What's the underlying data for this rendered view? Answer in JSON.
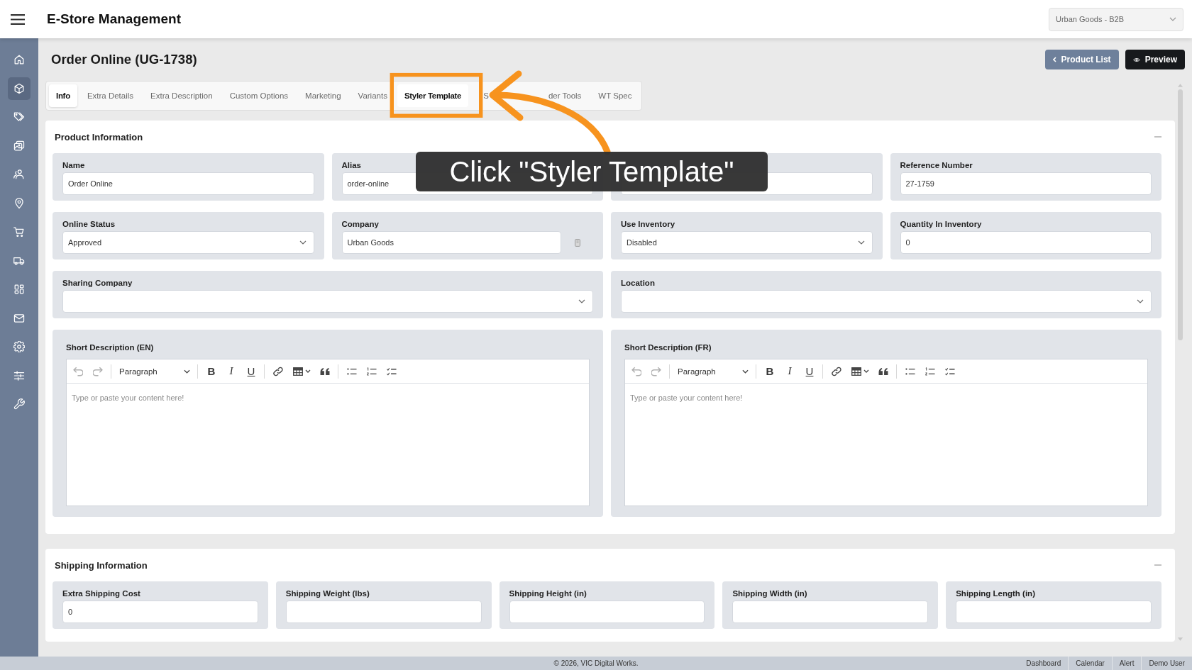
{
  "header": {
    "app_title": "E-Store Management",
    "store_selector": {
      "value": "Urban Goods - B2B"
    }
  },
  "sidebar": {
    "items": [
      {
        "selected": false
      },
      {
        "selected": true
      },
      {
        "selected": false
      },
      {
        "selected": false
      },
      {
        "selected": false
      },
      {
        "selected": false
      },
      {
        "selected": false
      },
      {
        "selected": false
      },
      {
        "selected": false
      },
      {
        "selected": false
      },
      {
        "selected": false
      },
      {
        "selected": false
      },
      {
        "selected": false
      }
    ]
  },
  "page": {
    "title": "Order Online (UG-1738)",
    "actions": [
      {
        "label": "Product List",
        "kind": "back"
      },
      {
        "label": "Preview",
        "kind": "preview"
      }
    ]
  },
  "tabs": [
    {
      "label": "Info",
      "selected": true,
      "hovered": false,
      "kind": "full"
    },
    {
      "label": "Extra Details",
      "selected": false,
      "hovered": false,
      "kind": "full"
    },
    {
      "label": "Extra Description",
      "selected": false,
      "hovered": false,
      "kind": "full"
    },
    {
      "label": "Custom Options",
      "selected": false,
      "hovered": false,
      "kind": "full"
    },
    {
      "label": "Marketing",
      "selected": false,
      "hovered": false,
      "kind": "full"
    },
    {
      "label": "Variants",
      "selected": false,
      "hovered": false,
      "kind": "full"
    },
    {
      "label": "Styler Template",
      "selected": false,
      "hovered": true,
      "kind": "full"
    },
    {
      "label": "S",
      "selected": false,
      "hovered": false,
      "kind": "cut_end"
    },
    {
      "label": "der Tools",
      "selected": false,
      "hovered": false,
      "kind": "cut_start"
    },
    {
      "label": "WT Spec",
      "selected": false,
      "hovered": false,
      "kind": "full"
    }
  ],
  "callout": {
    "text": "Click \"Styler Template\""
  },
  "product_information": {
    "title": "Product Information",
    "rows": [
      [
        {
          "kind": "text",
          "label": "Name",
          "value": "Order Online"
        },
        {
          "kind": "text",
          "label": "Alias",
          "value": "order-online"
        },
        {
          "kind": "text"
        },
        {
          "kind": "text",
          "label": "Reference Number",
          "value": "27-1759"
        }
      ],
      [
        {
          "kind": "select",
          "label": "Online Status",
          "value": "Approved"
        },
        {
          "kind": "text_with_icon",
          "label": "Company",
          "value": "Urban Goods"
        },
        {
          "kind": "select",
          "label": "Use Inventory",
          "value": "Disabled"
        },
        {
          "kind": "text",
          "label": "Quantity In Inventory",
          "value": "0"
        }
      ],
      [
        {
          "kind": "select",
          "label": "Sharing Company"
        },
        {
          "kind": "select",
          "label": "Location"
        }
      ],
      [
        {
          "kind": "editor",
          "label": "Short Description (EN)",
          "undo_disabled": true,
          "redo_disabled": true,
          "block_format": "Paragraph",
          "format_buttons": [
            "B",
            "I",
            "U"
          ],
          "placeholder": "Type or paste your content here!"
        },
        {
          "kind": "editor",
          "label": "Short Description (FR)",
          "undo_disabled": true,
          "redo_disabled": true,
          "block_format": "Paragraph",
          "format_buttons": [
            "B",
            "I",
            "U"
          ],
          "placeholder": "Type or paste your content here!"
        }
      ]
    ]
  },
  "shipping_information": {
    "title": "Shipping Information",
    "fields": [
      {
        "label": "Extra Shipping Cost",
        "value": "0"
      },
      {
        "label": "Shipping Weight (lbs)"
      },
      {
        "label": "Shipping Height (in)"
      },
      {
        "label": "Shipping Width (in)"
      },
      {
        "label": "Shipping Length (in)"
      }
    ]
  },
  "footer": {
    "copyright": "© 2026, VIC Digital Works.",
    "links": [
      "Dashboard",
      "Calendar",
      "Alert",
      "Demo User"
    ]
  }
}
